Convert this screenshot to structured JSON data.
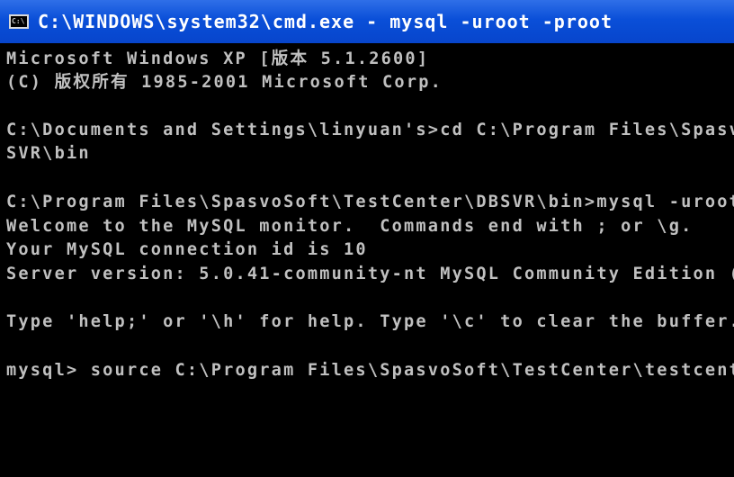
{
  "window": {
    "title": "C:\\WINDOWS\\system32\\cmd.exe - mysql -uroot -proot",
    "icon": "cmd-window-icon",
    "icon_glyph": "C:\\"
  },
  "console": {
    "lines": [
      "Microsoft Windows XP [版本 5.1.2600]",
      "(C) 版权所有 1985-2001 Microsoft Corp.",
      "",
      "C:\\Documents and Settings\\linyuan's>cd C:\\Program Files\\Spasv",
      "SVR\\bin",
      "",
      "C:\\Program Files\\SpasvoSoft\\TestCenter\\DBSVR\\bin>mysql -uroot",
      "Welcome to the MySQL monitor.  Commands end with ; or \\g.",
      "Your MySQL connection id is 10",
      "Server version: 5.0.41-community-nt MySQL Community Edition (",
      "",
      "Type 'help;' or '\\h' for help. Type '\\c' to clear the buffer.",
      "",
      "mysql> source C:\\Program Files\\SpasvoSoft\\TestCenter\\testcent"
    ]
  },
  "colors": {
    "titlebar": "#0a4fd8",
    "title_text": "#ffffff",
    "console_bg": "#000000",
    "console_text": "#c0c0c0"
  }
}
